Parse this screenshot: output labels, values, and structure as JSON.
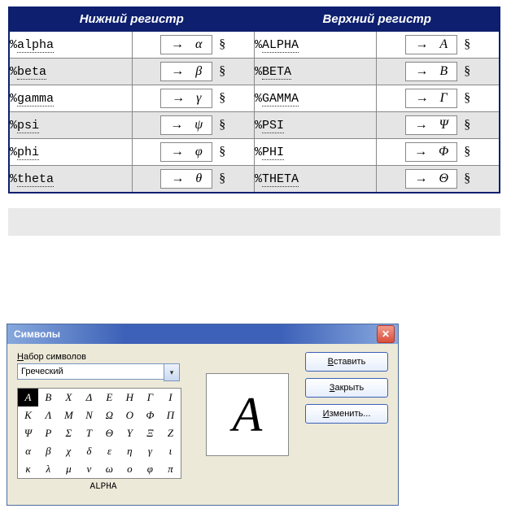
{
  "table": {
    "header_lower": "Нижний регистр",
    "header_upper": "Верхний регистр",
    "section_mark": "§",
    "arrow": "→",
    "rows": [
      {
        "lcode": "alpha",
        "lsym": "α",
        "ucode": "ALPHA",
        "usym": "A",
        "bg": "white"
      },
      {
        "lcode": "beta",
        "lsym": "β",
        "ucode": "BETA",
        "usym": "B",
        "bg": "grey"
      },
      {
        "lcode": "gamma",
        "lsym": "γ",
        "ucode": "GAMMA",
        "usym": "Γ",
        "bg": "white"
      },
      {
        "lcode": "psi",
        "lsym": "ψ",
        "ucode": "PSI",
        "usym": "Ψ",
        "bg": "grey"
      },
      {
        "lcode": "phi",
        "lsym": "φ",
        "ucode": "PHI",
        "usym": "Φ",
        "bg": "white"
      },
      {
        "lcode": "theta",
        "lsym": "θ",
        "ucode": "THETA",
        "usym": "Θ",
        "bg": "grey"
      }
    ]
  },
  "dialog": {
    "title": "Символы",
    "subset_label_pre": "Н",
    "subset_label_rest": "абор символов",
    "subset_value": "Греческий",
    "selected_index": 0,
    "selected_name": "ALPHA",
    "selected_glyph": "A",
    "grid": [
      [
        "A",
        "B",
        "X",
        "Δ",
        "E",
        "H",
        "Γ",
        "I"
      ],
      [
        "K",
        "Λ",
        "M",
        "N",
        "Ω",
        "O",
        "Φ",
        "Π"
      ],
      [
        "Ψ",
        "P",
        "Σ",
        "T",
        "Θ",
        "Y",
        "Ξ",
        "Z"
      ],
      [
        "α",
        "β",
        "χ",
        "δ",
        "ε",
        "η",
        "γ",
        "ι"
      ],
      [
        "κ",
        "λ",
        "μ",
        "ν",
        "ω",
        "ο",
        "φ",
        "π"
      ]
    ],
    "btn_insert_pre": "В",
    "btn_insert_rest": "ставить",
    "btn_close_pre": "З",
    "btn_close_rest": "акрыть",
    "btn_edit_pre": "И",
    "btn_edit_rest": "зменить..."
  }
}
